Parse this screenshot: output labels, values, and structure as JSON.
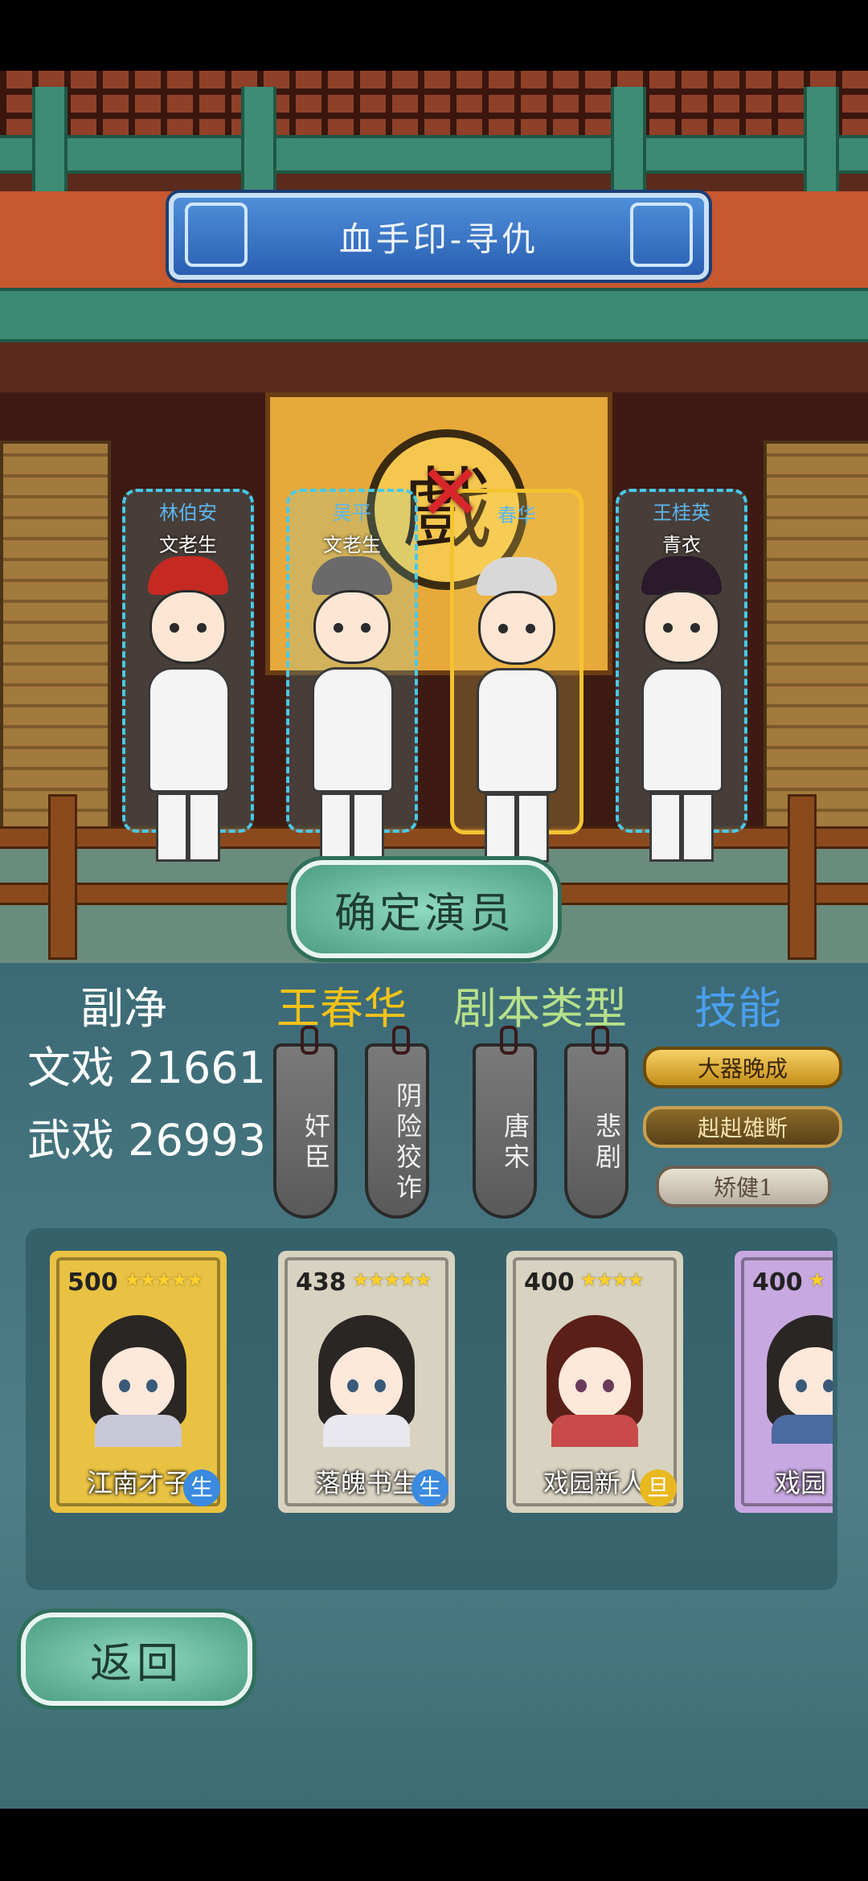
{
  "play_title": "血手印-寻仇",
  "stage_sign_char": "戲",
  "candidates": [
    {
      "name": "林伯安",
      "role": "文老生"
    },
    {
      "name": "吴平",
      "role": "文老生"
    },
    {
      "name": "",
      "role": "春华"
    },
    {
      "name": "王桂英",
      "role": "青衣"
    }
  ],
  "confirm_label": "确定演员",
  "headers": {
    "role_type": "副净",
    "character": "王春华",
    "script_type": "剧本类型",
    "skills": "技能"
  },
  "stats": {
    "wen": "文戏 21661",
    "wu": "武戏 26993"
  },
  "character_tags": [
    "奸臣",
    "阴险狡诈"
  ],
  "script_tags": [
    "唐宋",
    "悲剧"
  ],
  "skills": [
    "大器晚成",
    "赳赳雄断",
    "矫健1"
  ],
  "cards": [
    {
      "score": "500",
      "stars": "★★★★★",
      "name": "江南才子",
      "badge": "生"
    },
    {
      "score": "438",
      "stars": "★★★★★",
      "name": "落魄书生",
      "badge": "生"
    },
    {
      "score": "400",
      "stars": "★★★★",
      "name": "戏园新人",
      "badge": "旦"
    },
    {
      "score": "400",
      "stars": "★",
      "name": "戏园",
      "badge": ""
    }
  ],
  "back_label": "返回",
  "colors": {
    "selected": "#f4c430",
    "dashed": "#49c8e8",
    "header_yellow": "#f2c218",
    "header_green": "#b8e08a",
    "header_blue": "#4aa0f0"
  }
}
